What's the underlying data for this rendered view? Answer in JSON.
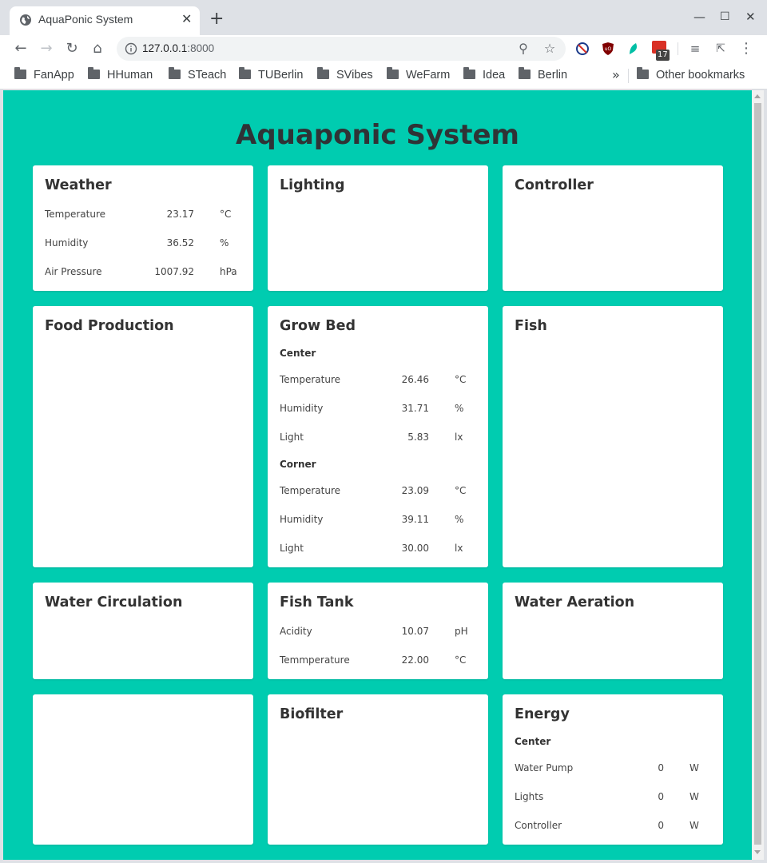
{
  "browser": {
    "tab_title": "AquaPonic System",
    "url_host": "127.0.0.1",
    "url_port": ":8000",
    "extension_badge": "17",
    "bookmarks": [
      "FanApp",
      "HHuman",
      "STeach",
      "TUBerlin",
      "SVibes",
      "WeFarm",
      "Idea",
      "Berlin"
    ],
    "more_bookmarks": "»",
    "other_bookmarks": "Other bookmarks"
  },
  "page": {
    "title": "Aquaponic System",
    "accent_color": "#00ccb0",
    "cards": {
      "weather": {
        "title": "Weather",
        "rows": [
          {
            "label": "Temperature",
            "value": "23.17",
            "unit": "°C"
          },
          {
            "label": "Humidity",
            "value": "36.52",
            "unit": "%"
          },
          {
            "label": "Air Pressure",
            "value": "1007.92",
            "unit": "hPa"
          }
        ]
      },
      "lighting": {
        "title": "Lighting"
      },
      "controller": {
        "title": "Controller"
      },
      "food_production": {
        "title": "Food Production"
      },
      "grow_bed": {
        "title": "Grow Bed",
        "sections": [
          {
            "name": "Center",
            "rows": [
              {
                "label": "Temperature",
                "value": "26.46",
                "unit": "°C"
              },
              {
                "label": "Humidity",
                "value": "31.71",
                "unit": "%"
              },
              {
                "label": "Light",
                "value": "5.83",
                "unit": "lx"
              }
            ]
          },
          {
            "name": "Corner",
            "rows": [
              {
                "label": "Temperature",
                "value": "23.09",
                "unit": "°C"
              },
              {
                "label": "Humidity",
                "value": "39.11",
                "unit": "%"
              },
              {
                "label": "Light",
                "value": "30.00",
                "unit": "lx"
              }
            ]
          }
        ]
      },
      "fish": {
        "title": "Fish"
      },
      "water_circulation": {
        "title": "Water Circulation"
      },
      "fish_tank": {
        "title": "Fish Tank",
        "rows": [
          {
            "label": "Acidity",
            "value": "10.07",
            "unit": "pH"
          },
          {
            "label": "Temmperature",
            "value": "22.00",
            "unit": "°C"
          }
        ]
      },
      "water_aeration": {
        "title": "Water Aeration"
      },
      "blank": {
        "title": ""
      },
      "biofilter": {
        "title": "Biofilter"
      },
      "energy": {
        "title": "Energy",
        "sections": [
          {
            "name": "Center",
            "rows": [
              {
                "label": "Water Pump",
                "value": "0",
                "unit": "W"
              },
              {
                "label": "Lights",
                "value": "0",
                "unit": "W"
              },
              {
                "label": "Controller",
                "value": "0",
                "unit": "W"
              }
            ]
          }
        ]
      }
    }
  }
}
